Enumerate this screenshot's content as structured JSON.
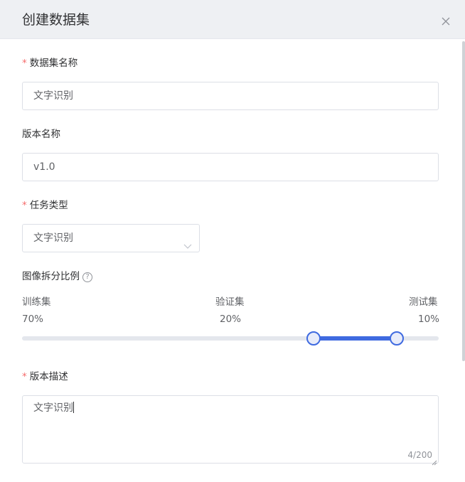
{
  "dialog": {
    "title": "创建数据集",
    "close_icon": "close-icon"
  },
  "form": {
    "dataset_name": {
      "required_mark": "*",
      "label": "数据集名称",
      "value": "文字识别"
    },
    "version_name": {
      "label": "版本名称",
      "value": "v1.0"
    },
    "task_type": {
      "required_mark": "*",
      "label": "任务类型",
      "value": "文字识别",
      "arrow_icon": "chevron-down-icon"
    },
    "split_ratio": {
      "label": "图像拆分比例",
      "help_icon": "question-circle-icon",
      "help_glyph": "?",
      "train": {
        "label": "训练集",
        "value": "70%"
      },
      "validation": {
        "label": "验证集",
        "value": "20%"
      },
      "test": {
        "label": "测试集",
        "value": "10%"
      },
      "slider_values": [
        0.7,
        0.9
      ]
    },
    "version_description": {
      "required_mark": "*",
      "label": "版本描述",
      "value": "文字识别",
      "counter": "4/200"
    }
  },
  "colors": {
    "accent": "#3f6ae0",
    "required": "#f56c6c",
    "border": "#dcdfe6",
    "header_bg": "#eef0f3"
  }
}
